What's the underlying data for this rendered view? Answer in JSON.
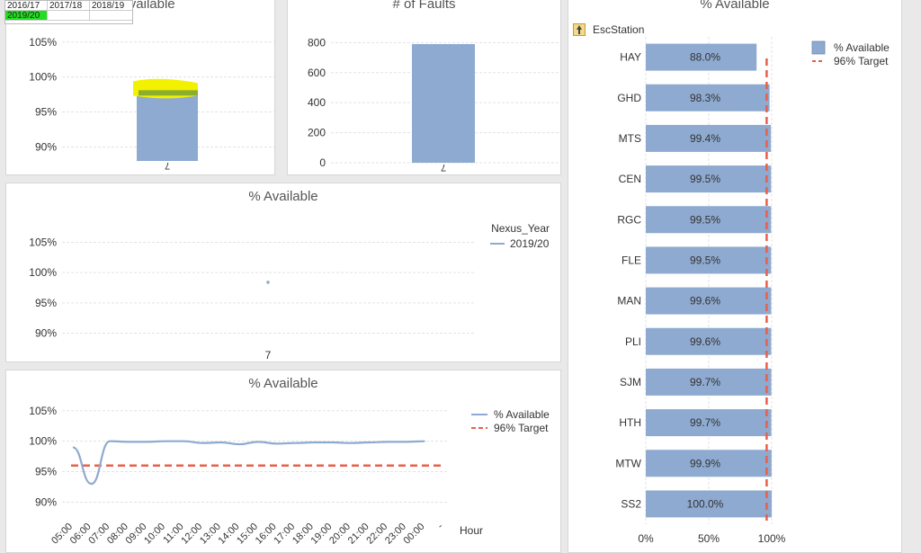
{
  "year_selector": {
    "years": [
      "2016/17",
      "2017/18",
      "2018/19",
      "2019/20"
    ],
    "selected": "2019/20"
  },
  "colors": {
    "bar": "#8eaad0",
    "target": "#e8604a",
    "selected": "#22dd22",
    "highlight": "#f2f200"
  },
  "chart_data": [
    {
      "id": "top-left-available",
      "type": "bar",
      "title": "% Available",
      "categories": [
        "7"
      ],
      "values": [
        97.6
      ],
      "ylim": [
        88,
        106
      ],
      "yticks": [
        90,
        95,
        100,
        105
      ],
      "ytick_labels": [
        "90%",
        "95%",
        "100%",
        "105%"
      ],
      "grid": true
    },
    {
      "id": "faults",
      "type": "bar",
      "title": "# of Faults",
      "categories": [
        "7"
      ],
      "values": [
        790
      ],
      "ylim": [
        0,
        850
      ],
      "yticks": [
        0,
        200,
        400,
        600,
        800
      ],
      "ytick_labels": [
        "0",
        "200",
        "400",
        "600",
        "800"
      ],
      "grid": true
    },
    {
      "id": "middle-available",
      "type": "scatter",
      "title": "% Available",
      "categories": [
        "7"
      ],
      "series": [
        {
          "name": "2019/20",
          "values": [
            98.4
          ]
        }
      ],
      "legend_title": "Nexus_Year",
      "ylim": [
        88,
        107
      ],
      "yticks": [
        90,
        95,
        100,
        105
      ],
      "ytick_labels": [
        "90%",
        "95%",
        "100%",
        "105%"
      ],
      "grid": true
    },
    {
      "id": "hourly-available",
      "type": "line",
      "title": "% Available",
      "xlabel": "Hour",
      "categories": [
        "05:00",
        "06:00",
        "07:00",
        "08:00",
        "09:00",
        "10:00",
        "11:00",
        "12:00",
        "13:00",
        "14:00",
        "15:00",
        "16:00",
        "17:00",
        "18:00",
        "19:00",
        "20:00",
        "21:00",
        "22:00",
        "23:00",
        "00:00",
        "-"
      ],
      "series": [
        {
          "name": "% Available",
          "values": [
            99.0,
            93.0,
            100.0,
            99.9,
            99.9,
            100.0,
            100.0,
            99.7,
            99.8,
            99.5,
            99.9,
            99.6,
            99.7,
            99.8,
            99.8,
            99.7,
            99.8,
            99.9,
            99.9,
            100.0,
            null
          ]
        },
        {
          "name": "96% Target",
          "values": [
            96,
            96,
            96,
            96,
            96,
            96,
            96,
            96,
            96,
            96,
            96,
            96,
            96,
            96,
            96,
            96,
            96,
            96,
            96,
            96,
            96
          ],
          "dashed": true
        }
      ],
      "ylim": [
        88,
        106
      ],
      "yticks": [
        90,
        95,
        100,
        105
      ],
      "ytick_labels": [
        "90%",
        "95%",
        "100%",
        "105%"
      ],
      "grid": true
    },
    {
      "id": "station-available",
      "type": "bar",
      "orientation": "horizontal",
      "title": "% Available",
      "dimension_label": "EscStation",
      "categories": [
        "HAY",
        "GHD",
        "MTS",
        "CEN",
        "RGC",
        "FLE",
        "MAN",
        "PLI",
        "SJM",
        "HTH",
        "MTW",
        "SS2"
      ],
      "values": [
        88.0,
        98.3,
        99.4,
        99.5,
        99.5,
        99.5,
        99.6,
        99.6,
        99.7,
        99.7,
        99.9,
        100.0
      ],
      "value_labels": [
        "88.0%",
        "98.3%",
        "99.4%",
        "99.5%",
        "99.5%",
        "99.5%",
        "99.6%",
        "99.6%",
        "99.7%",
        "99.7%",
        "99.9%",
        "100.0%"
      ],
      "series": [
        {
          "name": "% Available"
        },
        {
          "name": "96% Target",
          "value": 96
        }
      ],
      "xlim": [
        0,
        100
      ],
      "xticks": [
        0,
        50,
        100
      ],
      "xtick_labels": [
        "0%",
        "50%",
        "100%"
      ],
      "grid": true
    }
  ]
}
